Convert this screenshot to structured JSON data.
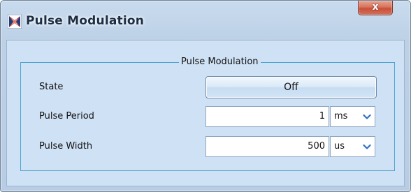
{
  "window": {
    "title": "Pulse Modulation",
    "close_label": "x",
    "icon": "app-logo-icon"
  },
  "group": {
    "legend": "Pulse Modulation"
  },
  "state": {
    "label": "State",
    "button_label": "Off"
  },
  "pulse_period": {
    "label": "Pulse Period",
    "value": "1",
    "unit": "ms"
  },
  "pulse_width": {
    "label": "Pulse Width",
    "value": "500",
    "unit": "us"
  },
  "colors": {
    "accent_border": "#4fa3cf",
    "chevron": "#2f6fc0",
    "close_red": "#c8503a"
  }
}
